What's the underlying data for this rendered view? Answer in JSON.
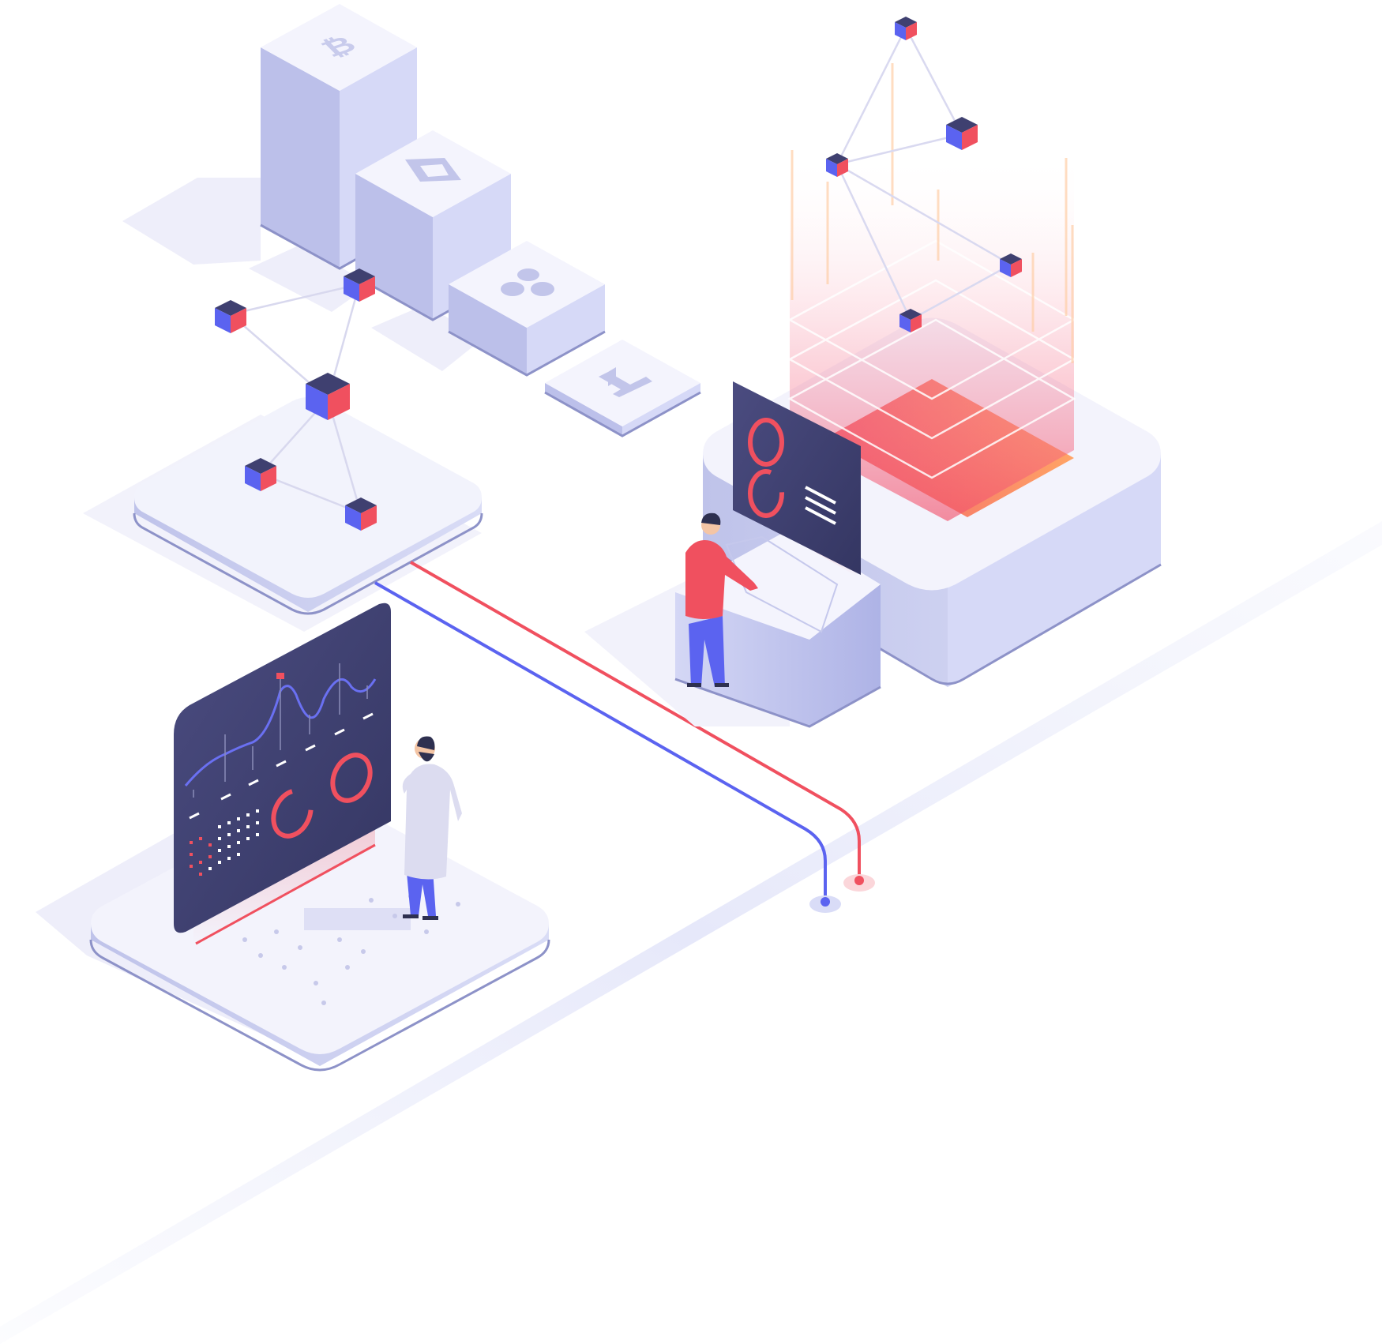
{
  "scene": {
    "background": "#ffffff",
    "colors": {
      "platform_top": "#f3f3fc",
      "platform_side": "#c9cdef",
      "platform_edge": "#8d92c8",
      "accent_red": "#f0505f",
      "accent_blue": "#5b63f0",
      "dark_panel": "#3d3f6e",
      "orange_glow": "#ff9a5c"
    },
    "coin_icons": [
      "bitcoin-icon",
      "ethereum-icon",
      "ripple-icon",
      "litecoin-icon"
    ],
    "figures": [
      "analyst-with-beard",
      "operator-in-red-sweater"
    ]
  }
}
